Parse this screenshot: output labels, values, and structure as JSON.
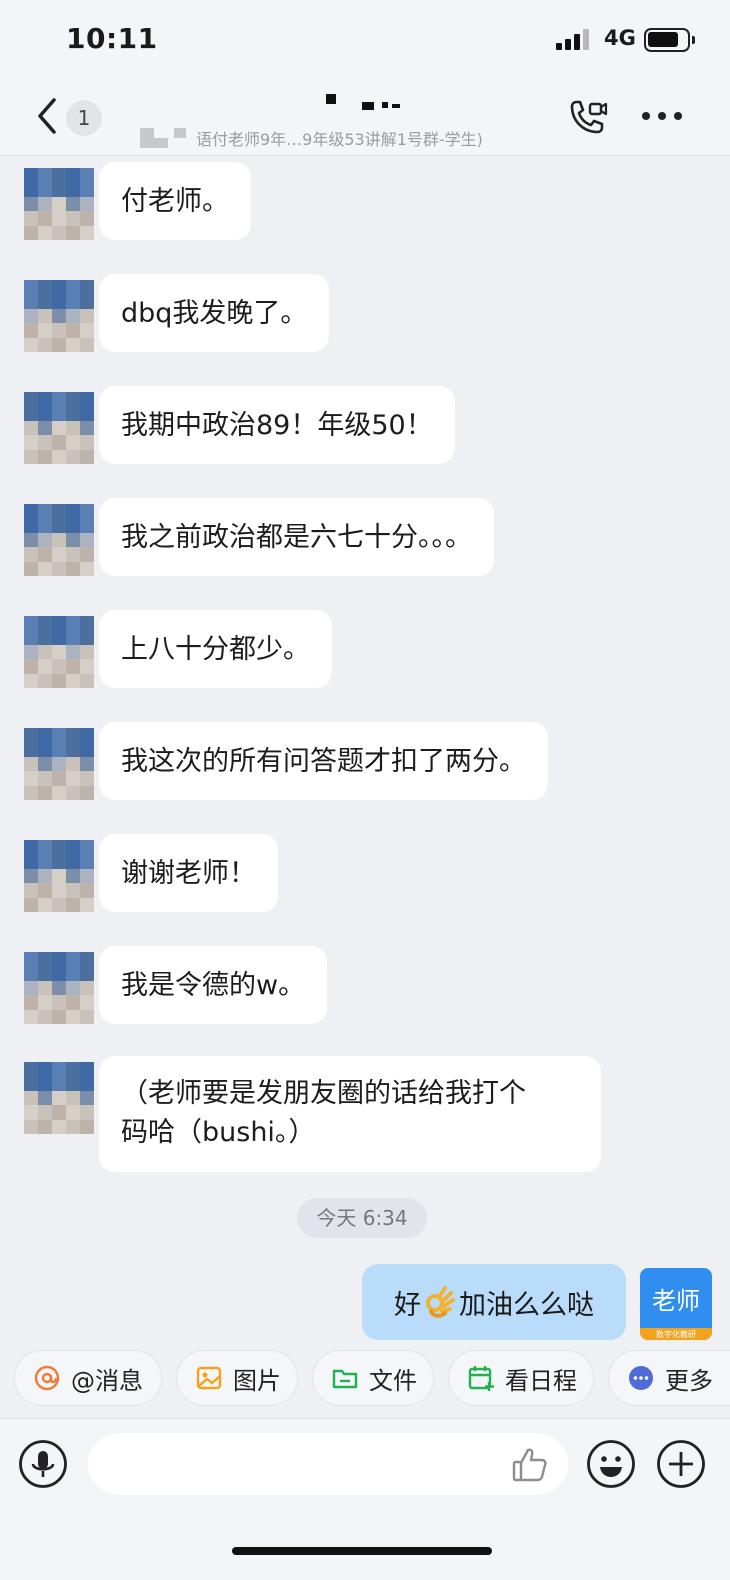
{
  "status_bar": {
    "time": "10:11",
    "network": "4G"
  },
  "header": {
    "back_badge": "1",
    "subtitle": "语付老师9年…9年级53讲解1号群-学生)",
    "icons": [
      "back-arrow-icon",
      "video-call-icon",
      "more-icon"
    ]
  },
  "messages": [
    {
      "text": "付老师。"
    },
    {
      "text": "dbq我发晚了。"
    },
    {
      "text": "我期中政治89！年级50！"
    },
    {
      "text": "我之前政治都是六七十分。。。"
    },
    {
      "text": "上八十分都少。"
    },
    {
      "text": "我这次的所有问答题才扣了两分。"
    },
    {
      "text": "谢谢老师！"
    },
    {
      "text": "我是令德的w。"
    },
    {
      "line1": "（老师要是发朋友圈的话给我打个",
      "line2": "码哈（bushi。）"
    }
  ],
  "time_divider": "今天 6:34",
  "my_message": {
    "before": "好",
    "after": "加油么么哒",
    "emoji": "ok-hand-icon"
  },
  "my_avatar": {
    "label": "老师",
    "tag": "数字化教研"
  },
  "quick_actions": [
    {
      "label": "@消息",
      "icon": "at-icon",
      "color": "#f07a3a"
    },
    {
      "label": "图片",
      "icon": "image-icon",
      "color": "#f3a21e"
    },
    {
      "label": "文件",
      "icon": "folder-icon",
      "color": "#22b14c"
    },
    {
      "label": "看日程",
      "icon": "calendar-icon",
      "color": "#22b14c"
    },
    {
      "label": "更多",
      "icon": "more-dots-icon",
      "color": "#4f6bd8"
    }
  ],
  "input": {
    "placeholder": ""
  },
  "colors": {
    "accent": "#2f8ef0",
    "my_bubble": "#b9dcfb",
    "background": "#eef0f4"
  }
}
